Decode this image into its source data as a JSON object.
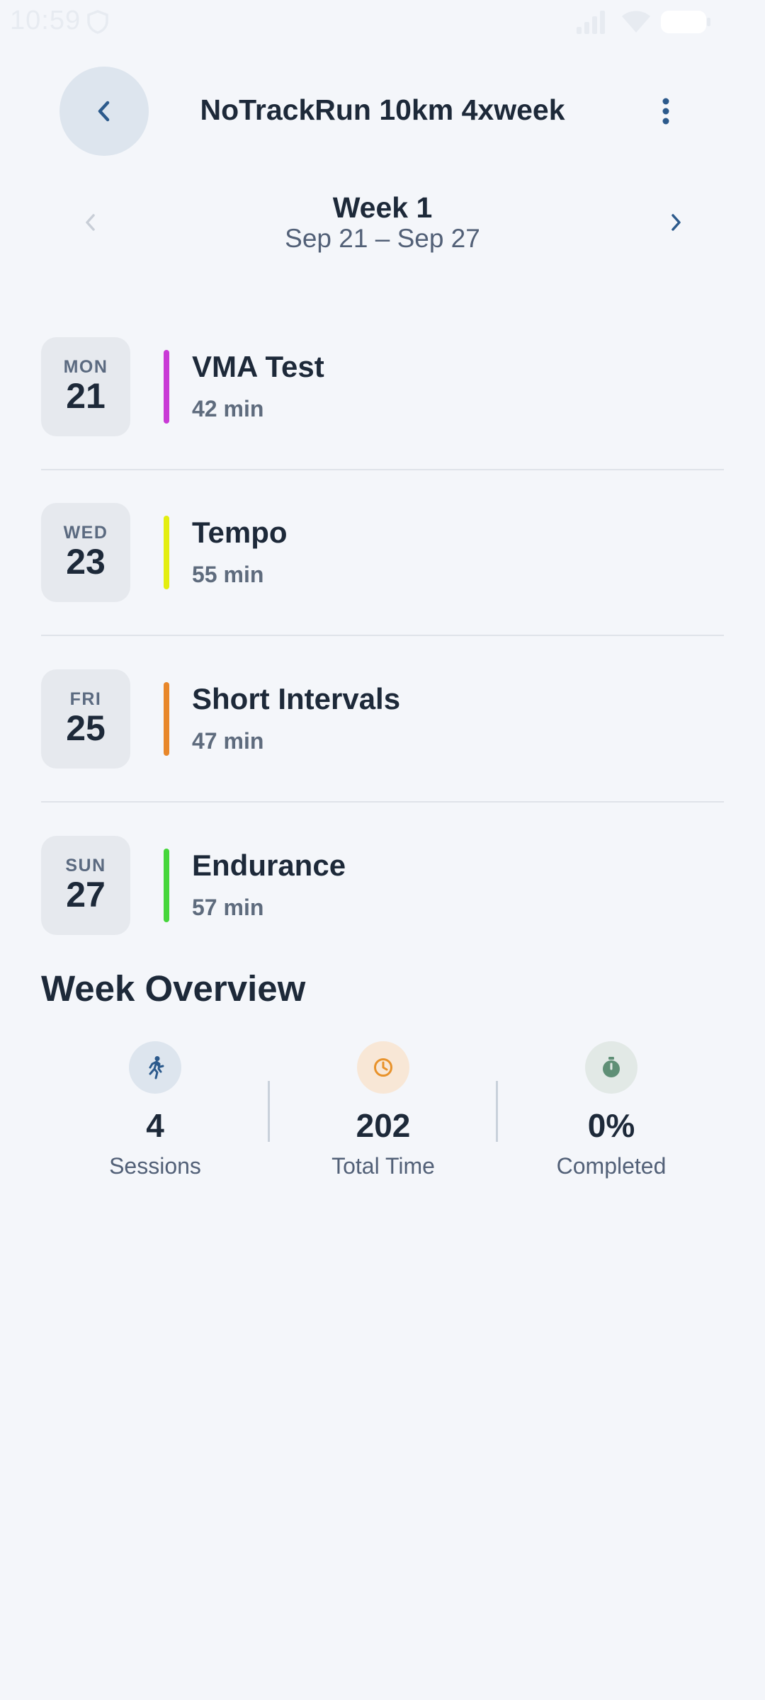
{
  "status_bar": {
    "time": "10:59"
  },
  "header": {
    "title": "NoTrackRun 10km 4xweek",
    "back_icon": "chevron-left-icon",
    "more_icon": "more-vert-icon"
  },
  "week": {
    "title": "Week 1",
    "range": "Sep 21 – Sep 27"
  },
  "sessions": [
    {
      "dow": "MON",
      "day": "21",
      "name": "VMA Test",
      "duration": "42 min",
      "color": "#c93ad6"
    },
    {
      "dow": "WED",
      "day": "23",
      "name": "Tempo",
      "duration": "55 min",
      "color": "#e3ee10"
    },
    {
      "dow": "FRI",
      "day": "25",
      "name": "Short Intervals",
      "duration": "47 min",
      "color": "#e8872a"
    },
    {
      "dow": "SUN",
      "day": "27",
      "name": "Endurance",
      "duration": "57 min",
      "color": "#45d63a"
    }
  ],
  "overview": {
    "title": "Week Overview",
    "stats": [
      {
        "value": "4",
        "label": "Sessions",
        "icon": "runner-icon",
        "icon_bg": "#dde5ee",
        "icon_color": "#2c5a8c"
      },
      {
        "value": "202",
        "label": "Total Time",
        "icon": "clock-icon",
        "icon_bg": "#f8e7d6",
        "icon_color": "#e8922a"
      },
      {
        "value": "0%",
        "label": "Completed",
        "icon": "stopwatch-icon",
        "icon_bg": "#e2e9e6",
        "icon_color": "#5f8f76"
      }
    ]
  }
}
